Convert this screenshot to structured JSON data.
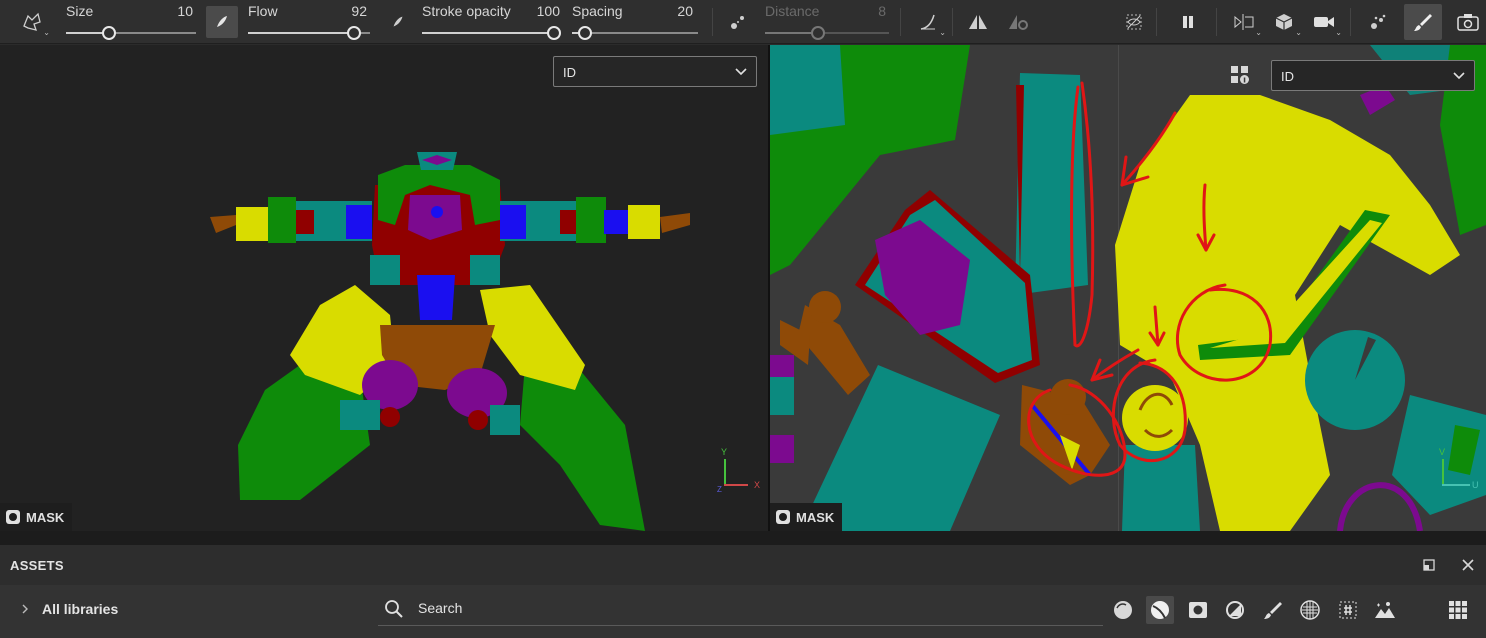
{
  "toolbar": {
    "size": {
      "label": "Size",
      "value": "10",
      "fraction": 0.33
    },
    "flow": {
      "label": "Flow",
      "value": "92",
      "fraction": 0.92
    },
    "stroke_opacity": {
      "label": "Stroke opacity",
      "value": "100",
      "fraction": 1.0
    },
    "spacing": {
      "label": "Spacing",
      "value": "20",
      "fraction": 0.08
    },
    "distance": {
      "label": "Distance",
      "value": "8",
      "fraction": 0.5,
      "disabled": true
    }
  },
  "viewport_3d": {
    "channel_select": "ID",
    "mask_label": "MASK",
    "axes": {
      "y": "Y",
      "x": "X",
      "z": "Z"
    }
  },
  "viewport_2d": {
    "channel_select": "ID",
    "mask_label": "MASK",
    "axes": {
      "v": "V",
      "u": "U"
    }
  },
  "assets": {
    "title": "ASSETS",
    "libraries_label": "All libraries",
    "search_placeholder": "Search",
    "filter_icons": [
      "material-ball-icon",
      "smart-material-icon",
      "mask-icon",
      "filter-icon",
      "brush-icon",
      "texture-icon",
      "alpha-icon",
      "environment-icon"
    ]
  },
  "colors": {
    "accent_active": "#4b4b4b",
    "id_green": "#0e8b0a",
    "id_yellow": "#d9dc00",
    "id_teal": "#0b8a7f",
    "id_darkred": "#900000",
    "id_purple": "#7c0a8f",
    "id_brown": "#8f4a07",
    "id_blue": "#1a0ff0",
    "annotation_red": "#e01616"
  }
}
